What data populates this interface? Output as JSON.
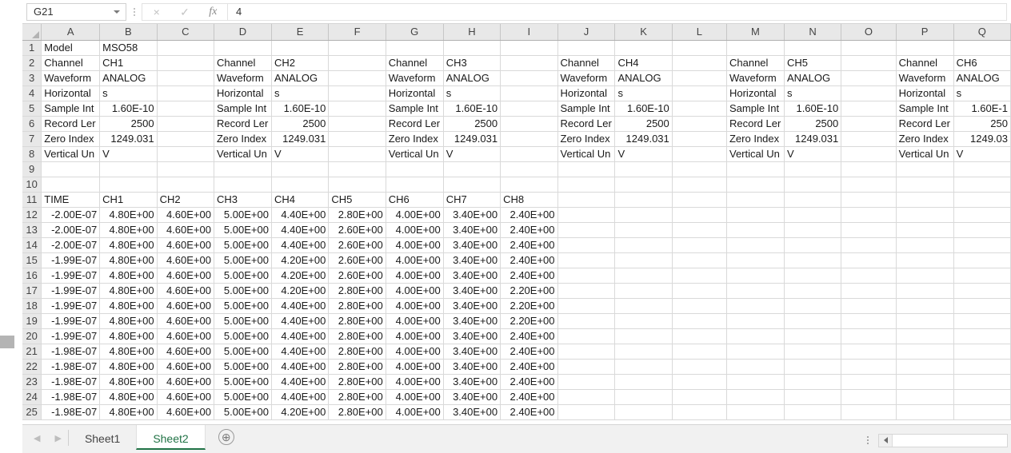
{
  "formula_bar": {
    "name_box_value": "G21",
    "cancel_icon": "×",
    "enter_icon": "✓",
    "function_icon": "fx",
    "formula_value": "4"
  },
  "grid": {
    "column_headers": [
      "A",
      "B",
      "C",
      "D",
      "E",
      "F",
      "G",
      "H",
      "I",
      "J",
      "K",
      "L",
      "M",
      "N",
      "O",
      "P",
      "Q"
    ],
    "row_numbers": [
      1,
      2,
      3,
      4,
      5,
      6,
      7,
      8,
      9,
      10,
      11,
      12,
      13,
      14,
      15,
      16,
      17,
      18,
      19,
      20,
      21,
      22,
      23,
      24,
      25
    ],
    "rows": [
      [
        "Model",
        "MSO58",
        "",
        "",
        "",
        "",
        "",
        "",
        "",
        "",
        "",
        "",
        "",
        "",
        "",
        "",
        ""
      ],
      [
        "Channel",
        "CH1",
        "",
        "Channel",
        "CH2",
        "",
        "Channel",
        "CH3",
        "",
        "Channel",
        "CH4",
        "",
        "Channel",
        "CH5",
        "",
        "Channel",
        "CH6"
      ],
      [
        "Waveform",
        "ANALOG",
        "",
        "Waveform",
        "ANALOG",
        "",
        "Waveform",
        "ANALOG",
        "",
        "Waveform",
        "ANALOG",
        "",
        "Waveform",
        "ANALOG",
        "",
        "Waveform",
        "ANALOG"
      ],
      [
        "Horizontal",
        "s",
        "",
        "Horizontal",
        "s",
        "",
        "Horizontal",
        "s",
        "",
        "Horizontal",
        "s",
        "",
        "Horizontal",
        "s",
        "",
        "Horizontal",
        "s"
      ],
      [
        "Sample Int",
        "1.60E-10",
        "",
        "Sample Int",
        "1.60E-10",
        "",
        "Sample Int",
        "1.60E-10",
        "",
        "Sample Int",
        "1.60E-10",
        "",
        "Sample Int",
        "1.60E-10",
        "",
        "Sample Int",
        "1.60E-1"
      ],
      [
        "Record Ler",
        "2500",
        "",
        "Record Ler",
        "2500",
        "",
        "Record Ler",
        "2500",
        "",
        "Record Ler",
        "2500",
        "",
        "Record Ler",
        "2500",
        "",
        "Record Ler",
        "250"
      ],
      [
        "Zero Index",
        "1249.031",
        "",
        "Zero Index",
        "1249.031",
        "",
        "Zero Index",
        "1249.031",
        "",
        "Zero Index",
        "1249.031",
        "",
        "Zero Index",
        "1249.031",
        "",
        "Zero Index",
        "1249.03"
      ],
      [
        "Vertical Un",
        "V",
        "",
        "Vertical Un",
        "V",
        "",
        "Vertical Un",
        "V",
        "",
        "Vertical Un",
        "V",
        "",
        "Vertical Un",
        "V",
        "",
        "Vertical Un",
        "V"
      ],
      [
        "",
        "",
        "",
        "",
        "",
        "",
        "",
        "",
        "",
        "",
        "",
        "",
        "",
        "",
        "",
        "",
        ""
      ],
      [
        "",
        "",
        "",
        "",
        "",
        "",
        "",
        "",
        "",
        "",
        "",
        "",
        "",
        "",
        "",
        "",
        ""
      ],
      [
        "TIME",
        "CH1",
        "CH2",
        "CH3",
        "CH4",
        "CH5",
        "CH6",
        "CH7",
        "CH8",
        "",
        "",
        "",
        "",
        "",
        "",
        "",
        ""
      ],
      [
        "-2.00E-07",
        "4.80E+00",
        "4.60E+00",
        "5.00E+00",
        "4.40E+00",
        "2.80E+00",
        "4.00E+00",
        "3.40E+00",
        "2.40E+00",
        "",
        "",
        "",
        "",
        "",
        "",
        "",
        ""
      ],
      [
        "-2.00E-07",
        "4.80E+00",
        "4.60E+00",
        "5.00E+00",
        "4.40E+00",
        "2.60E+00",
        "4.00E+00",
        "3.40E+00",
        "2.40E+00",
        "",
        "",
        "",
        "",
        "",
        "",
        "",
        ""
      ],
      [
        "-2.00E-07",
        "4.80E+00",
        "4.60E+00",
        "5.00E+00",
        "4.40E+00",
        "2.60E+00",
        "4.00E+00",
        "3.40E+00",
        "2.40E+00",
        "",
        "",
        "",
        "",
        "",
        "",
        "",
        ""
      ],
      [
        "-1.99E-07",
        "4.80E+00",
        "4.60E+00",
        "5.00E+00",
        "4.20E+00",
        "2.60E+00",
        "4.00E+00",
        "3.40E+00",
        "2.40E+00",
        "",
        "",
        "",
        "",
        "",
        "",
        "",
        ""
      ],
      [
        "-1.99E-07",
        "4.80E+00",
        "4.60E+00",
        "5.00E+00",
        "4.20E+00",
        "2.60E+00",
        "4.00E+00",
        "3.40E+00",
        "2.40E+00",
        "",
        "",
        "",
        "",
        "",
        "",
        "",
        ""
      ],
      [
        "-1.99E-07",
        "4.80E+00",
        "4.60E+00",
        "5.00E+00",
        "4.20E+00",
        "2.80E+00",
        "4.00E+00",
        "3.40E+00",
        "2.20E+00",
        "",
        "",
        "",
        "",
        "",
        "",
        "",
        ""
      ],
      [
        "-1.99E-07",
        "4.80E+00",
        "4.60E+00",
        "5.00E+00",
        "4.40E+00",
        "2.80E+00",
        "4.00E+00",
        "3.40E+00",
        "2.20E+00",
        "",
        "",
        "",
        "",
        "",
        "",
        "",
        ""
      ],
      [
        "-1.99E-07",
        "4.80E+00",
        "4.60E+00",
        "5.00E+00",
        "4.40E+00",
        "2.80E+00",
        "4.00E+00",
        "3.40E+00",
        "2.20E+00",
        "",
        "",
        "",
        "",
        "",
        "",
        "",
        ""
      ],
      [
        "-1.99E-07",
        "4.80E+00",
        "4.60E+00",
        "5.00E+00",
        "4.40E+00",
        "2.80E+00",
        "4.00E+00",
        "3.40E+00",
        "2.40E+00",
        "",
        "",
        "",
        "",
        "",
        "",
        "",
        ""
      ],
      [
        "-1.98E-07",
        "4.80E+00",
        "4.60E+00",
        "5.00E+00",
        "4.40E+00",
        "2.80E+00",
        "4.00E+00",
        "3.40E+00",
        "2.40E+00",
        "",
        "",
        "",
        "",
        "",
        "",
        "",
        ""
      ],
      [
        "-1.98E-07",
        "4.80E+00",
        "4.60E+00",
        "5.00E+00",
        "4.40E+00",
        "2.80E+00",
        "4.00E+00",
        "3.40E+00",
        "2.40E+00",
        "",
        "",
        "",
        "",
        "",
        "",
        "",
        ""
      ],
      [
        "-1.98E-07",
        "4.80E+00",
        "4.60E+00",
        "5.00E+00",
        "4.40E+00",
        "2.80E+00",
        "4.00E+00",
        "3.40E+00",
        "2.40E+00",
        "",
        "",
        "",
        "",
        "",
        "",
        "",
        ""
      ],
      [
        "-1.98E-07",
        "4.80E+00",
        "4.60E+00",
        "5.00E+00",
        "4.40E+00",
        "2.80E+00",
        "4.00E+00",
        "3.40E+00",
        "2.40E+00",
        "",
        "",
        "",
        "",
        "",
        "",
        "",
        ""
      ],
      [
        "-1.98E-07",
        "4.80E+00",
        "4.60E+00",
        "5.00E+00",
        "4.20E+00",
        "2.80E+00",
        "4.00E+00",
        "3.40E+00",
        "2.40E+00",
        "",
        "",
        "",
        "",
        "",
        "",
        "",
        ""
      ]
    ],
    "numeric_right_aligned_columns": [
      0,
      1,
      2,
      3,
      4,
      5,
      6,
      7,
      8
    ]
  },
  "bottom": {
    "prev_sheet_icon": "◀",
    "next_sheet_icon": "▶",
    "tabs": [
      {
        "label": "Sheet1",
        "active": false
      },
      {
        "label": "Sheet2",
        "active": true
      }
    ],
    "add_sheet_icon": "⊕",
    "hscroll_left_icon": "◀"
  },
  "colors": {
    "active_tab_accent": "#217346",
    "header_bg": "#e8e8e8",
    "gridline": "#d9d9d9"
  }
}
